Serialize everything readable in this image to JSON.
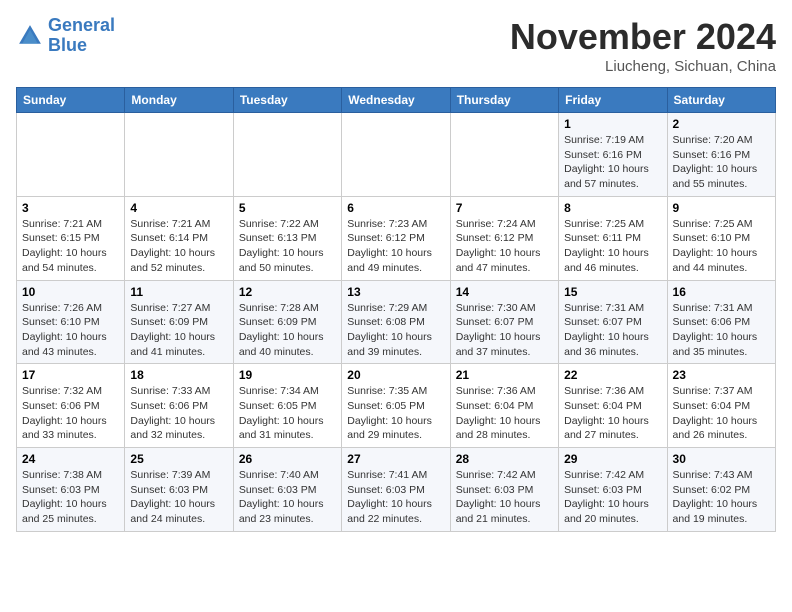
{
  "header": {
    "logo_line1": "General",
    "logo_line2": "Blue",
    "month": "November 2024",
    "location": "Liucheng, Sichuan, China"
  },
  "weekdays": [
    "Sunday",
    "Monday",
    "Tuesday",
    "Wednesday",
    "Thursday",
    "Friday",
    "Saturday"
  ],
  "weeks": [
    [
      {
        "day": "",
        "info": ""
      },
      {
        "day": "",
        "info": ""
      },
      {
        "day": "",
        "info": ""
      },
      {
        "day": "",
        "info": ""
      },
      {
        "day": "",
        "info": ""
      },
      {
        "day": "1",
        "info": "Sunrise: 7:19 AM\nSunset: 6:16 PM\nDaylight: 10 hours\nand 57 minutes."
      },
      {
        "day": "2",
        "info": "Sunrise: 7:20 AM\nSunset: 6:16 PM\nDaylight: 10 hours\nand 55 minutes."
      }
    ],
    [
      {
        "day": "3",
        "info": "Sunrise: 7:21 AM\nSunset: 6:15 PM\nDaylight: 10 hours\nand 54 minutes."
      },
      {
        "day": "4",
        "info": "Sunrise: 7:21 AM\nSunset: 6:14 PM\nDaylight: 10 hours\nand 52 minutes."
      },
      {
        "day": "5",
        "info": "Sunrise: 7:22 AM\nSunset: 6:13 PM\nDaylight: 10 hours\nand 50 minutes."
      },
      {
        "day": "6",
        "info": "Sunrise: 7:23 AM\nSunset: 6:12 PM\nDaylight: 10 hours\nand 49 minutes."
      },
      {
        "day": "7",
        "info": "Sunrise: 7:24 AM\nSunset: 6:12 PM\nDaylight: 10 hours\nand 47 minutes."
      },
      {
        "day": "8",
        "info": "Sunrise: 7:25 AM\nSunset: 6:11 PM\nDaylight: 10 hours\nand 46 minutes."
      },
      {
        "day": "9",
        "info": "Sunrise: 7:25 AM\nSunset: 6:10 PM\nDaylight: 10 hours\nand 44 minutes."
      }
    ],
    [
      {
        "day": "10",
        "info": "Sunrise: 7:26 AM\nSunset: 6:10 PM\nDaylight: 10 hours\nand 43 minutes."
      },
      {
        "day": "11",
        "info": "Sunrise: 7:27 AM\nSunset: 6:09 PM\nDaylight: 10 hours\nand 41 minutes."
      },
      {
        "day": "12",
        "info": "Sunrise: 7:28 AM\nSunset: 6:09 PM\nDaylight: 10 hours\nand 40 minutes."
      },
      {
        "day": "13",
        "info": "Sunrise: 7:29 AM\nSunset: 6:08 PM\nDaylight: 10 hours\nand 39 minutes."
      },
      {
        "day": "14",
        "info": "Sunrise: 7:30 AM\nSunset: 6:07 PM\nDaylight: 10 hours\nand 37 minutes."
      },
      {
        "day": "15",
        "info": "Sunrise: 7:31 AM\nSunset: 6:07 PM\nDaylight: 10 hours\nand 36 minutes."
      },
      {
        "day": "16",
        "info": "Sunrise: 7:31 AM\nSunset: 6:06 PM\nDaylight: 10 hours\nand 35 minutes."
      }
    ],
    [
      {
        "day": "17",
        "info": "Sunrise: 7:32 AM\nSunset: 6:06 PM\nDaylight: 10 hours\nand 33 minutes."
      },
      {
        "day": "18",
        "info": "Sunrise: 7:33 AM\nSunset: 6:06 PM\nDaylight: 10 hours\nand 32 minutes."
      },
      {
        "day": "19",
        "info": "Sunrise: 7:34 AM\nSunset: 6:05 PM\nDaylight: 10 hours\nand 31 minutes."
      },
      {
        "day": "20",
        "info": "Sunrise: 7:35 AM\nSunset: 6:05 PM\nDaylight: 10 hours\nand 29 minutes."
      },
      {
        "day": "21",
        "info": "Sunrise: 7:36 AM\nSunset: 6:04 PM\nDaylight: 10 hours\nand 28 minutes."
      },
      {
        "day": "22",
        "info": "Sunrise: 7:36 AM\nSunset: 6:04 PM\nDaylight: 10 hours\nand 27 minutes."
      },
      {
        "day": "23",
        "info": "Sunrise: 7:37 AM\nSunset: 6:04 PM\nDaylight: 10 hours\nand 26 minutes."
      }
    ],
    [
      {
        "day": "24",
        "info": "Sunrise: 7:38 AM\nSunset: 6:03 PM\nDaylight: 10 hours\nand 25 minutes."
      },
      {
        "day": "25",
        "info": "Sunrise: 7:39 AM\nSunset: 6:03 PM\nDaylight: 10 hours\nand 24 minutes."
      },
      {
        "day": "26",
        "info": "Sunrise: 7:40 AM\nSunset: 6:03 PM\nDaylight: 10 hours\nand 23 minutes."
      },
      {
        "day": "27",
        "info": "Sunrise: 7:41 AM\nSunset: 6:03 PM\nDaylight: 10 hours\nand 22 minutes."
      },
      {
        "day": "28",
        "info": "Sunrise: 7:42 AM\nSunset: 6:03 PM\nDaylight: 10 hours\nand 21 minutes."
      },
      {
        "day": "29",
        "info": "Sunrise: 7:42 AM\nSunset: 6:03 PM\nDaylight: 10 hours\nand 20 minutes."
      },
      {
        "day": "30",
        "info": "Sunrise: 7:43 AM\nSunset: 6:02 PM\nDaylight: 10 hours\nand 19 minutes."
      }
    ]
  ]
}
